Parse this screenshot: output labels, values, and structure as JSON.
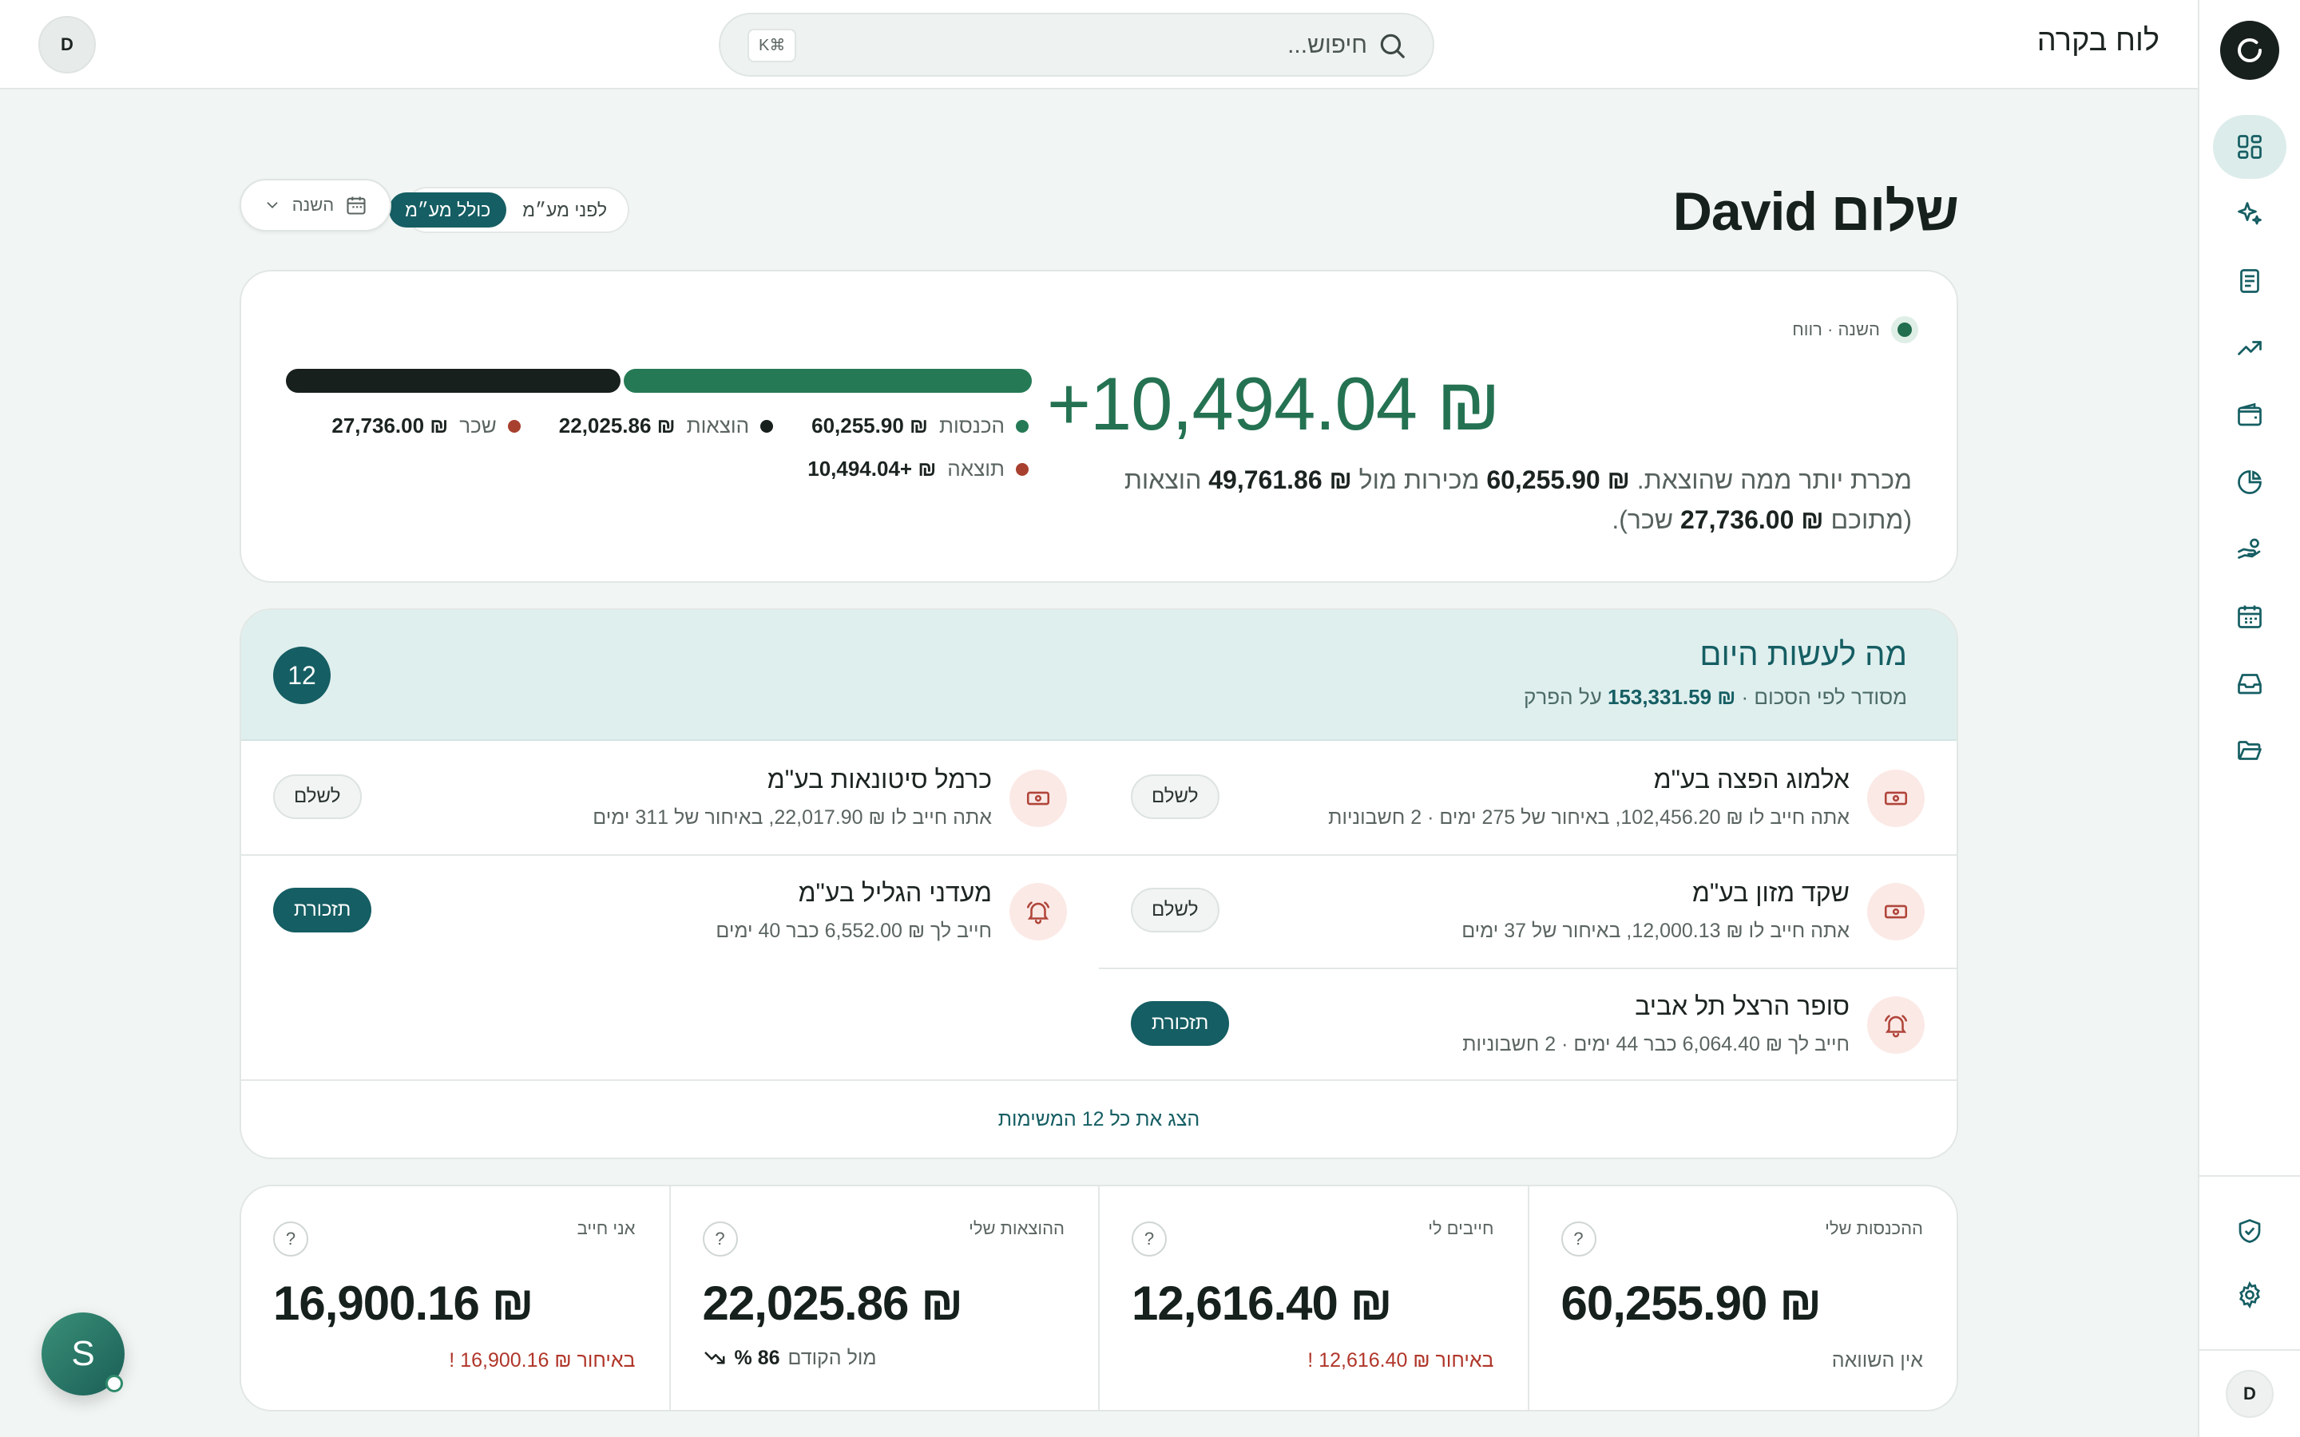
{
  "app": {
    "title": "לוח בקרה",
    "user_initial": "D"
  },
  "search": {
    "placeholder": "חיפוש...",
    "shortcut": "K⌘"
  },
  "greeting": "שלום David",
  "vat_toggle": {
    "options": [
      "לפני מע״מ",
      "כולל מע״מ"
    ],
    "selected": "כולל מע״מ"
  },
  "period": {
    "label": "השנה"
  },
  "sidebar": {
    "items": [
      {
        "icon": "dashboard-icon",
        "active": true
      },
      {
        "icon": "sparkles-icon",
        "active": false
      },
      {
        "icon": "document-icon",
        "active": false
      },
      {
        "icon": "trending-up-icon",
        "active": false
      },
      {
        "icon": "wallet-icon",
        "active": false
      },
      {
        "icon": "pie-chart-icon",
        "active": false
      },
      {
        "icon": "hand-coins-icon",
        "active": false
      },
      {
        "icon": "calendar-icon",
        "active": false
      },
      {
        "icon": "inbox-icon",
        "active": false
      },
      {
        "icon": "folder-icon",
        "active": false
      }
    ],
    "bottom": [
      {
        "icon": "shield-check-icon"
      },
      {
        "icon": "settings-icon"
      }
    ],
    "user_initial": "D"
  },
  "profit": {
    "label": "השנה · רווח",
    "amount": "+10,494.04 ₪",
    "desc_a": "מכרת יותר ממה שהוצאת. ",
    "income": "₪ 60,255.90",
    "desc_b": " מכירות מול ",
    "expenses_total": "₪ 49,761.86",
    "desc_c": " הוצאות (מתוכם ",
    "salary": "₪ 27,736.00",
    "desc_d": " שכר).",
    "bar": {
      "dark_fraction": 0.45,
      "green_fraction": 0.55
    },
    "legend": [
      {
        "label": "הכנסות",
        "value": "₪ 60,255.90",
        "color": "#257a55"
      },
      {
        "label": "הוצאות",
        "value": "₪ 22,025.86",
        "color": "#18201d"
      },
      {
        "label": "שכר",
        "value": "₪ 27,736.00",
        "color": "#a8402f"
      },
      {
        "label": "תוצאה",
        "value": "₪ +10,494.04",
        "color": "#a8402f"
      }
    ]
  },
  "tasks": {
    "title": "מה לעשות היום",
    "subtitle_a": "מסודר לפי הסכום · ",
    "subtitle_amount": "₪ 153,331.59",
    "subtitle_b": " על הפרק",
    "count": "12",
    "items": [
      {
        "name": "אלמוג הפצה בע\"מ",
        "info": "אתה חייב לו ₪ 102,456.20, באיחור של 275 ימים · 2 חשבוניות",
        "action": "לשלם",
        "icon": "money-icon",
        "primary": false
      },
      {
        "name": "כרמל סיטונאות בע\"מ",
        "info": "אתה חייב לו ₪ 22,017.90, באיחור של 311 ימים",
        "action": "לשלם",
        "icon": "money-icon",
        "primary": false
      },
      {
        "name": "שקד מזון בע\"מ",
        "info": "אתה חייב לו ₪ 12,000.13, באיחור של 37 ימים",
        "action": "לשלם",
        "icon": "money-icon",
        "primary": false
      },
      {
        "name": "מעדני הגליל בע\"מ",
        "info": "חייב לך ₪ 6,552.00 כבר 40 ימים",
        "action": "תזכורת",
        "icon": "bell-icon",
        "primary": true
      },
      {
        "name": "סופר הרצל תל אביב",
        "info": "חייב לך ₪ 6,064.40 כבר 44 ימים · 2 חשבוניות",
        "action": "תזכורת",
        "icon": "bell-icon",
        "primary": true
      }
    ],
    "footer": "הצג את כל 12 המשימות"
  },
  "stats": [
    {
      "title": "ההכנסות שלי",
      "value": "60,255.90 ₪",
      "note": "אין השוואה",
      "note_red": false,
      "trend": null
    },
    {
      "title": "חייבים לי",
      "value": "12,616.40 ₪",
      "note": "באיחור ₪ 12,616.40 !",
      "note_red": true,
      "trend": null
    },
    {
      "title": "ההוצאות שלי",
      "value": "22,025.86 ₪",
      "note": "",
      "note_red": false,
      "trend": {
        "value": "86 %",
        "label": "מול הקודם"
      }
    },
    {
      "title": "אני חייב",
      "value": "16,900.16 ₪",
      "note": "באיחור ₪ 16,900.16 !",
      "note_red": true,
      "trend": null
    }
  ],
  "help_avatar": {
    "initial": "S"
  },
  "colors": {
    "accent": "#155e63",
    "profit": "#247252",
    "danger": "#b0362a"
  }
}
